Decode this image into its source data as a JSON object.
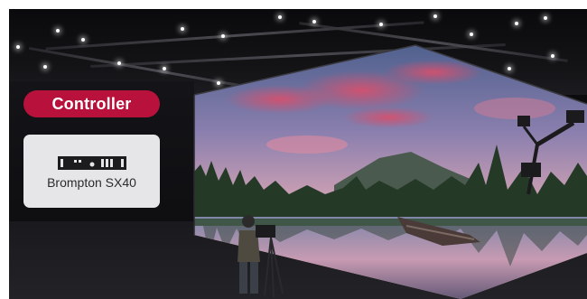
{
  "controller": {
    "label": "Controller"
  },
  "device": {
    "name": "Brompton SX40",
    "icon": "led-processor-icon"
  },
  "colors": {
    "accent": "#b8123c",
    "card": "#e6e6e8"
  }
}
